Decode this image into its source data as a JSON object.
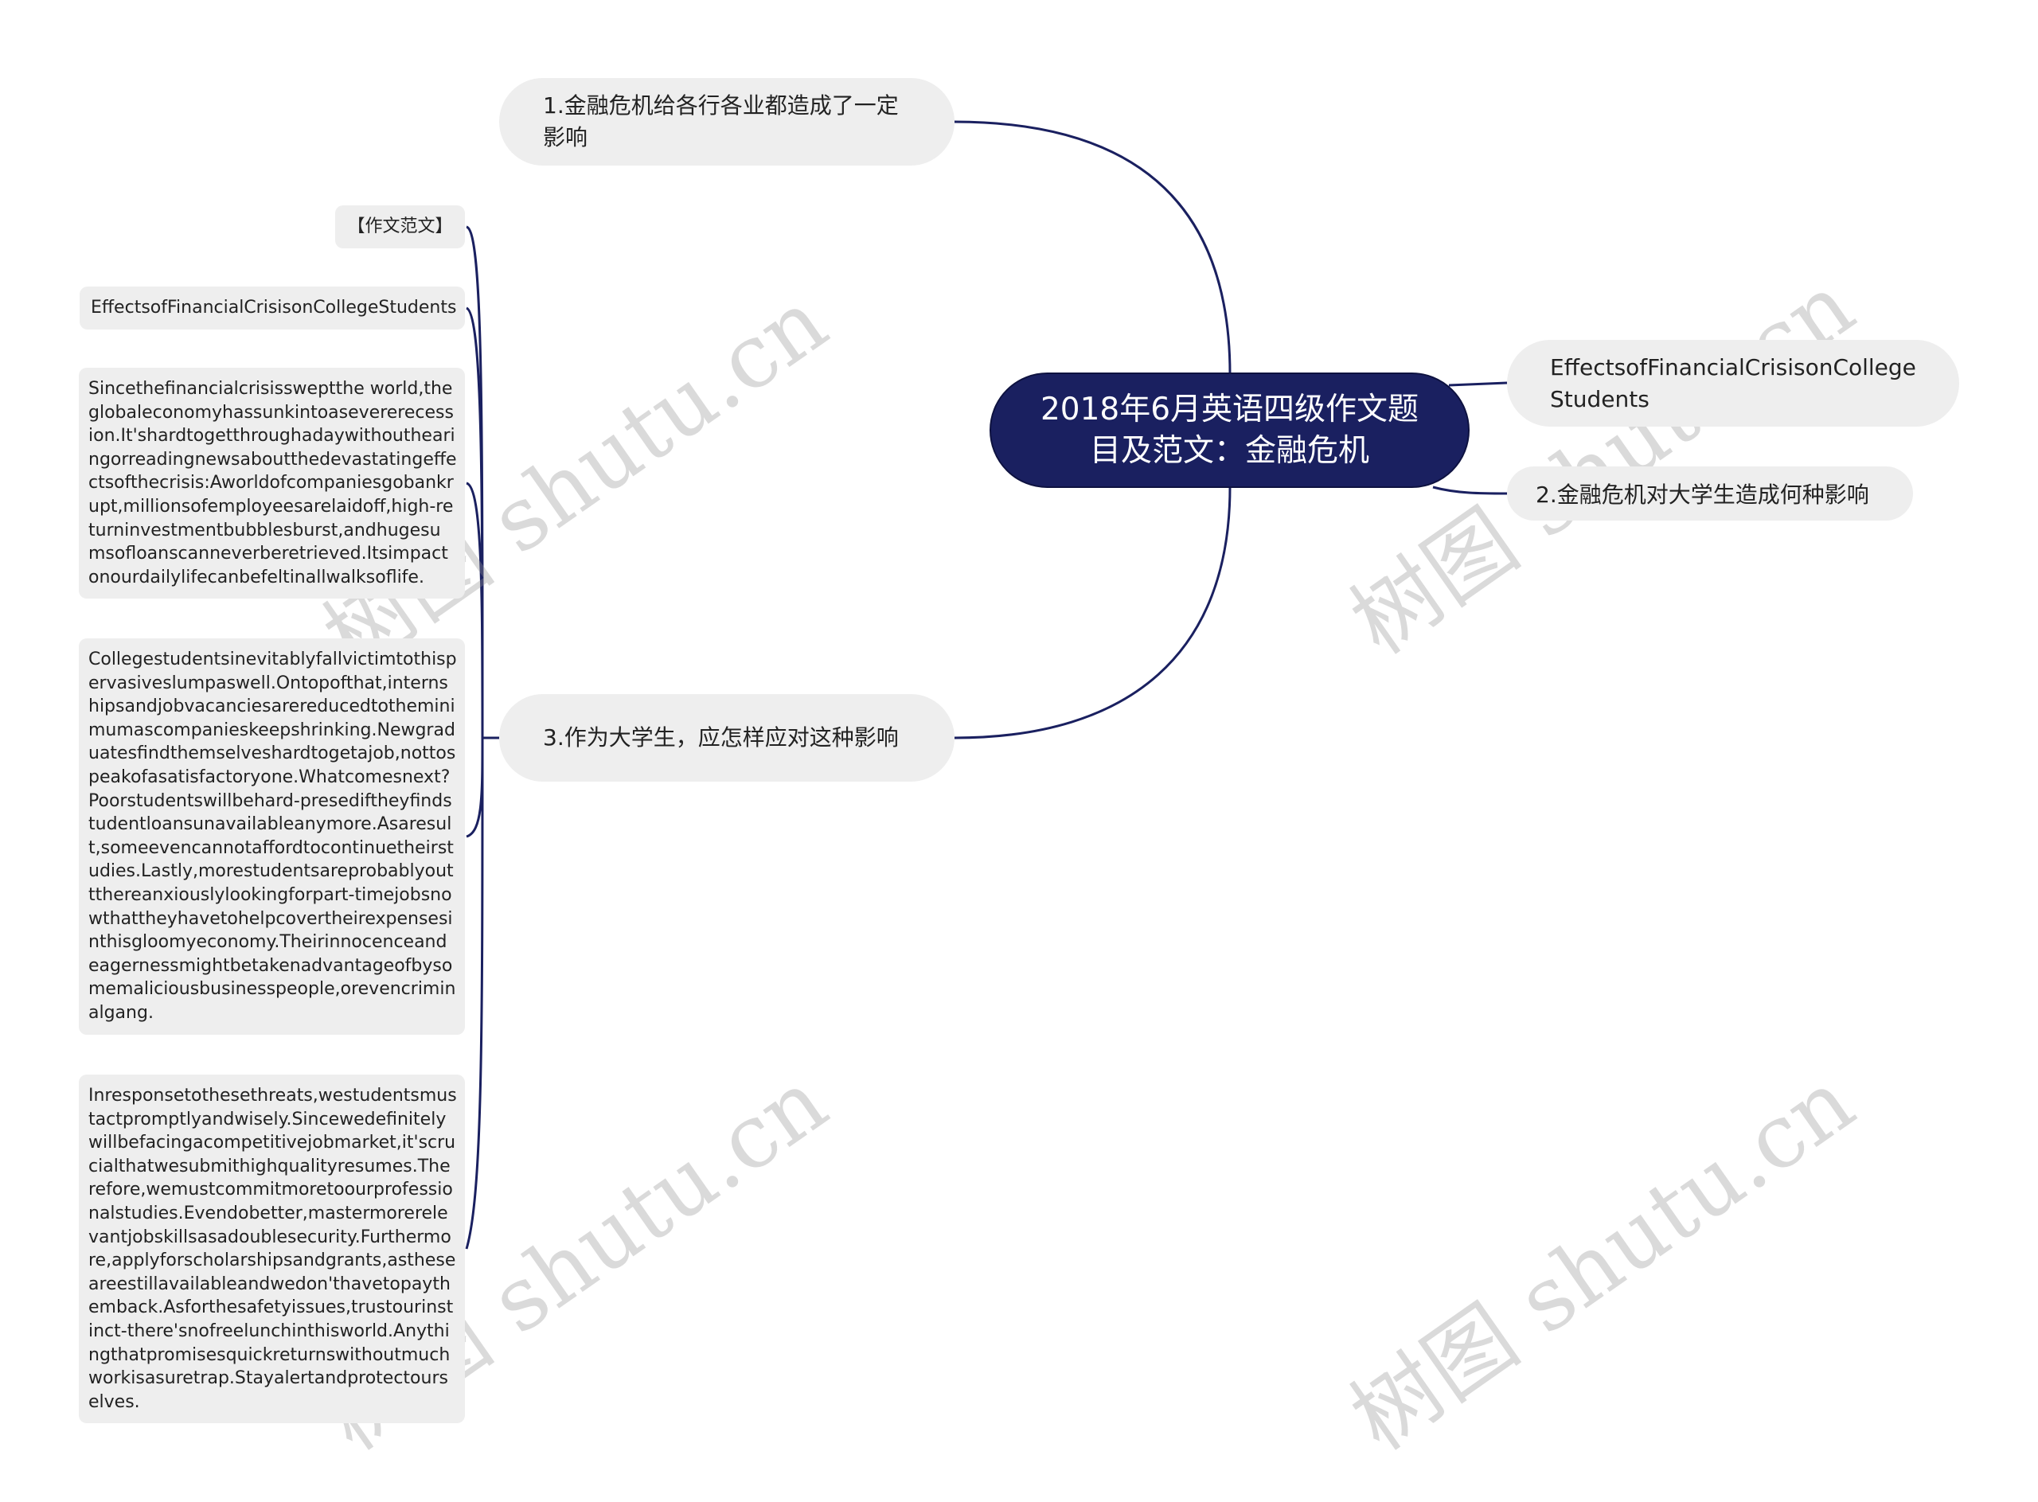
{
  "root": {
    "title": "2018年6月英语四级作文题目及范文：金融危机"
  },
  "branches": {
    "left_top": {
      "label": "1.金融危机给各行各业都造成了一定影响"
    },
    "left_bottom": {
      "label": "3.作为大学生，应怎样应对这种影响"
    },
    "right_top": {
      "label": "EffectsofFinancialCrisisonCollegeStudents"
    },
    "right_bottom": {
      "label": "2.金融危机对大学生造成何种影响"
    }
  },
  "leaves": {
    "title": "【作文范文】",
    "heading": "EffectsofFinancialCrisisonCollegeStudents",
    "paragraph1": "Sincethefinancialcrisissweptthe world,theglobaleconomyhassunkintoasevererecession.It'shardtogetthroughadaywithouthearingorreadingnewsaboutthedevastatingeffectsofthecrisis:Aworldofcompaniesgobankrupt,millionsofemployeesarelaidoff,high-returninvestmentbubblesburst,andhugesumsofloanscanneverberetrieved.Itsimpactonourdailylifecanbefeltinallwalksoflife.",
    "paragraph2": "Collegestudentsinevitablyfallvictimtothispervasiveslumpaswell.Ontopofthat,internshipsandjobvacanciesarereducedtotheminimumascompanieskeepshrinking.Newgraduatesfindthemselveshardtogetajob,nottospeakofasatisfactoryone.Whatcomesnext?Poorstudentswillbehard-presediftheyfindstudentloansunavailableanymore.Asaresult,someevencannotaffordtocontinuetheirstudies.Lastly,morestudentsareprobablyouttthereanxiouslylookingforpart-timejobsnowthattheyhavetohelpcovertheirexpensesinthisgloomyeconomy.Theirinnocenceandeagernessmightbetakenadvantageofbysomemaliciousbusinesspeople,orevencriminalgang.",
    "paragraph3": "Inresponsetothesethreats,westudentsmustactpromptlyandwisely.Sincewedefinitelywillbefacingacompetitivejobmarket,it'scrucialthatwesubmithighqualityresumes.Therefore,wemustcommitmoretoourprofessionalstudies.Evendobetter,mastermorerelevantjobskillsasadoublesecurity.Furthermore,applyforscholarshipsandgrants,astheseareestillavailableandwedon'thavetopaythemback.Asforthesafetyissues,trustourinstinct-there'snofreelunchinthisworld.Anythingthatpromisesquickreturnswithoutmuchworkisasuretrap.Stayalertandprotectourselves."
  },
  "watermark": "树图 shutu.cn",
  "colors": {
    "root_bg": "#1a2060",
    "node_bg": "#eeeeee",
    "link": "#1a2060"
  }
}
